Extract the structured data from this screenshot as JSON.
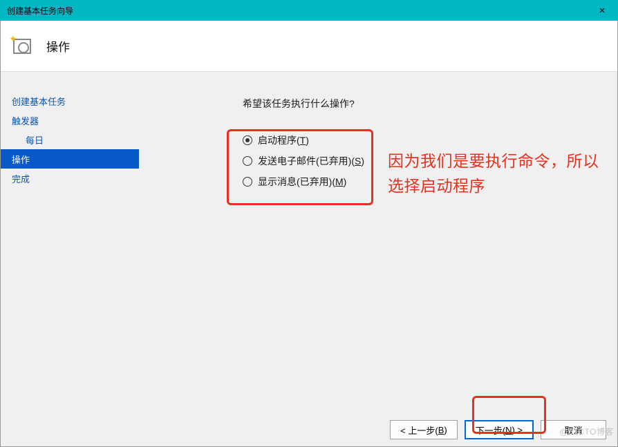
{
  "window": {
    "title": "创建基本任务向导",
    "close": "×"
  },
  "header": {
    "title": "操作"
  },
  "sidebar": {
    "items": [
      {
        "label": "创建基本任务",
        "level": 0
      },
      {
        "label": "触发器",
        "level": 0
      },
      {
        "label": "每日",
        "level": 1
      },
      {
        "label": "操作",
        "level": 0,
        "selected": true
      },
      {
        "label": "完成",
        "level": 0
      }
    ]
  },
  "main": {
    "prompt": "希望该任务执行什么操作?",
    "options": [
      {
        "label": "启动程序(",
        "accel": "T",
        "tail": ")",
        "checked": true
      },
      {
        "label": "发送电子邮件(已弃用)(",
        "accel": "S",
        "tail": ")",
        "checked": false
      },
      {
        "label": "显示消息(已弃用)(",
        "accel": "M",
        "tail": ")",
        "checked": false
      }
    ]
  },
  "annotation": "因为我们是要执行命令，所以选择启动程序",
  "buttons": {
    "back": {
      "pre": "< 上一步(",
      "accel": "B",
      "post": ")"
    },
    "next": {
      "pre": "下一步(",
      "accel": "N",
      "post": ") >"
    },
    "cancel": {
      "pre": "取消",
      "accel": "",
      "post": ""
    }
  },
  "watermark": "@51CTO博客"
}
